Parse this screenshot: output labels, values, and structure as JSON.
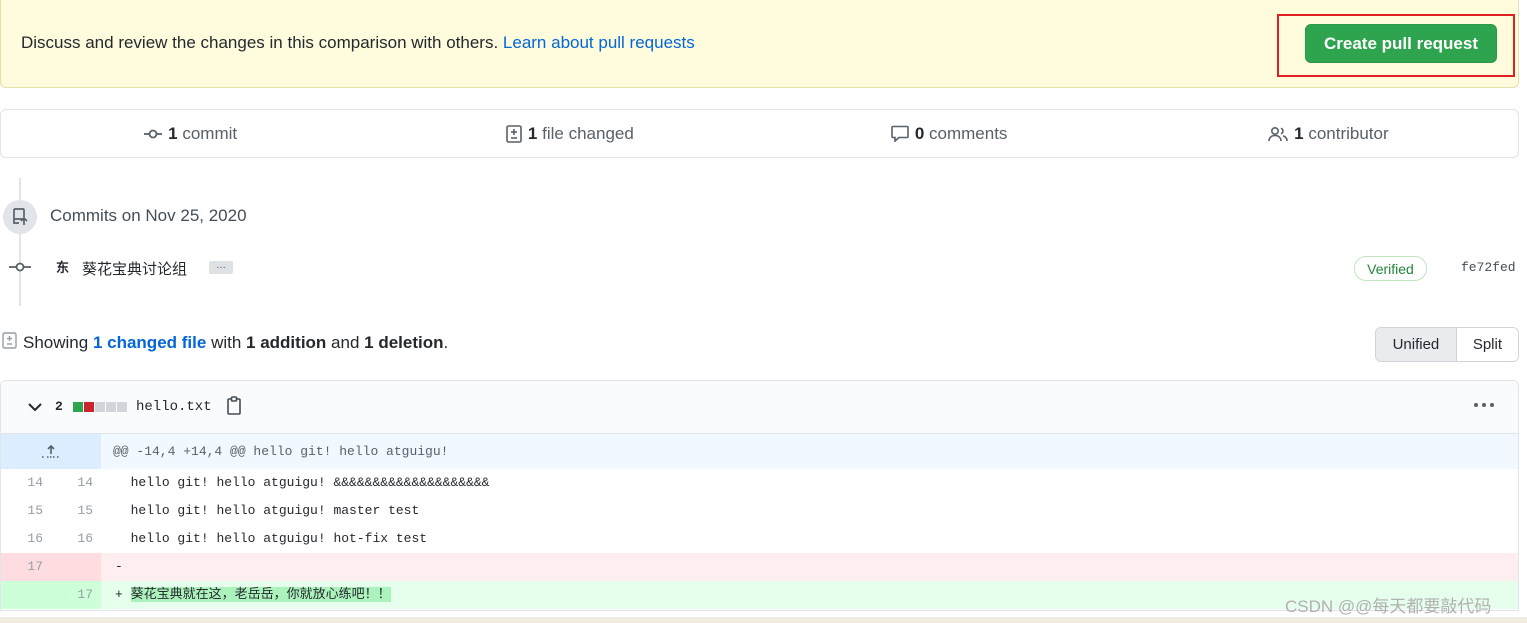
{
  "banner": {
    "text": "Discuss and review the changes in this comparison with others.",
    "link": "Learn about pull requests",
    "button": "Create pull request"
  },
  "stats": {
    "commits": {
      "count": "1",
      "label": "commit"
    },
    "files": {
      "count": "1",
      "label": "file changed"
    },
    "comments": {
      "count": "0",
      "label": "comments"
    },
    "contributors": {
      "count": "1",
      "label": "contributor"
    }
  },
  "commits": {
    "heading": "Commits on Nov 25, 2020",
    "avatar": "东",
    "message": "葵花宝典讨论组",
    "ellipsis": "…",
    "verified": "Verified",
    "sha": "fe72fed"
  },
  "summary": {
    "showing": "Showing",
    "changed_link": "1 changed file",
    "with": "with",
    "additions": "1 addition",
    "and": "and",
    "deletions": "1 deletion",
    "period": "."
  },
  "view_toggle": {
    "unified": "Unified",
    "split": "Split"
  },
  "file": {
    "change_count": "2",
    "name": "hello.txt",
    "hunk": "@@ -14,4 +14,4 @@ hello git! hello atguigu!",
    "lines": [
      {
        "old": "14",
        "new": "14",
        "sign": " ",
        "text": "hello git! hello atguigu! &&&&&&&&&&&&&&&&&&&&"
      },
      {
        "old": "15",
        "new": "15",
        "sign": " ",
        "text": "hello git! hello atguigu! master test"
      },
      {
        "old": "16",
        "new": "16",
        "sign": " ",
        "text": "hello git! hello atguigu! hot-fix test"
      },
      {
        "old": "17",
        "new": "",
        "sign": "-",
        "text": ""
      },
      {
        "old": "",
        "new": "17",
        "sign": "+",
        "text": "葵花宝典就在这，老岳岳，你就放心练吧！！"
      }
    ]
  },
  "watermark": "CSDN @@每天都要敲代码",
  "colors": {
    "accent": "#0366d6",
    "success": "#2ea44f",
    "deletion": "#cb2431",
    "highlight": "#e02020"
  }
}
